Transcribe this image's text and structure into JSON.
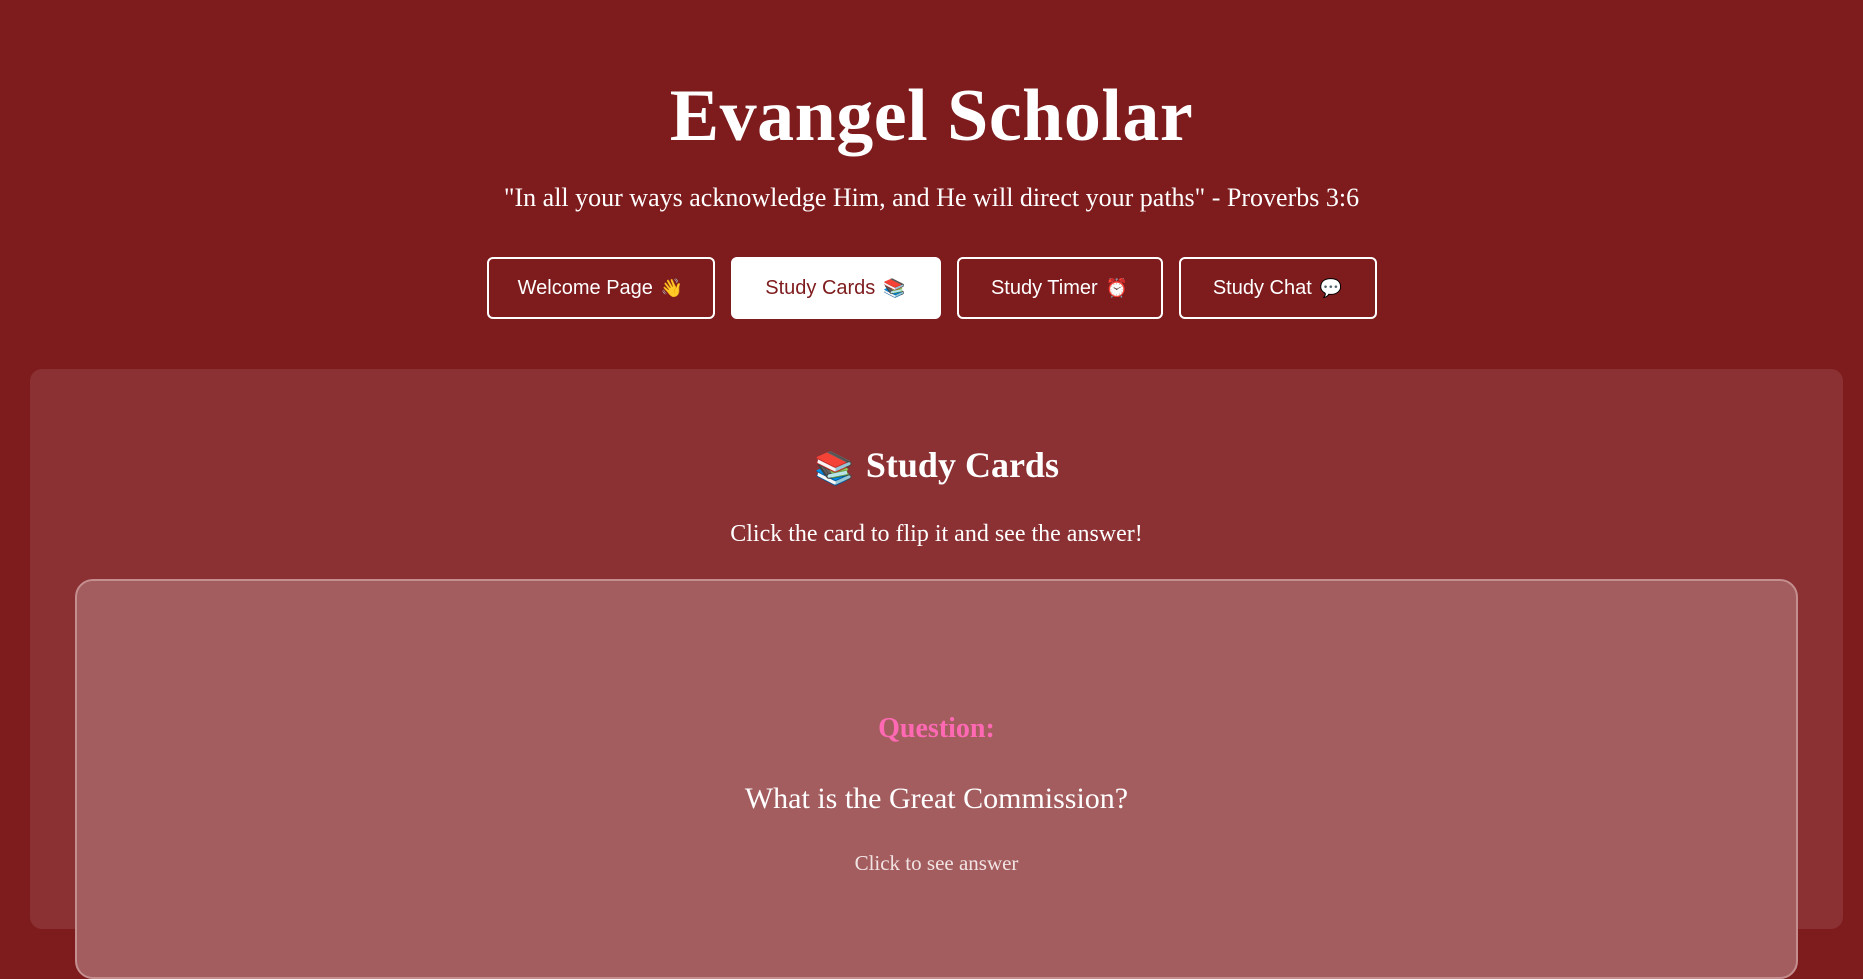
{
  "header": {
    "title": "Evangel Scholar",
    "verse": "\"In all your ways acknowledge Him, and He will direct your paths\" - Proverbs 3:6"
  },
  "nav": {
    "items": [
      {
        "label": "Welcome Page",
        "emoji": "👋",
        "icon": "waving-hand-icon",
        "active": false
      },
      {
        "label": "Study Cards",
        "emoji": "📚",
        "icon": "books-icon",
        "active": true
      },
      {
        "label": "Study Timer",
        "emoji": "⏰",
        "icon": "alarm-clock-icon",
        "active": false
      },
      {
        "label": "Study Chat",
        "emoji": "💬",
        "icon": "speech-bubble-icon",
        "active": false
      }
    ]
  },
  "study_cards": {
    "icon": "📚",
    "title": "Study Cards",
    "instructions": "Click the card to flip it and see the answer!",
    "card": {
      "side_label": "Question:",
      "question": "What is the Great Commission?",
      "hint": "Click to see answer"
    }
  },
  "colors": {
    "background": "#7e1b1d",
    "panel": "#8b3133",
    "card": "#a35d5f",
    "accent_pink": "#ff69b4",
    "text": "#ffffff"
  }
}
